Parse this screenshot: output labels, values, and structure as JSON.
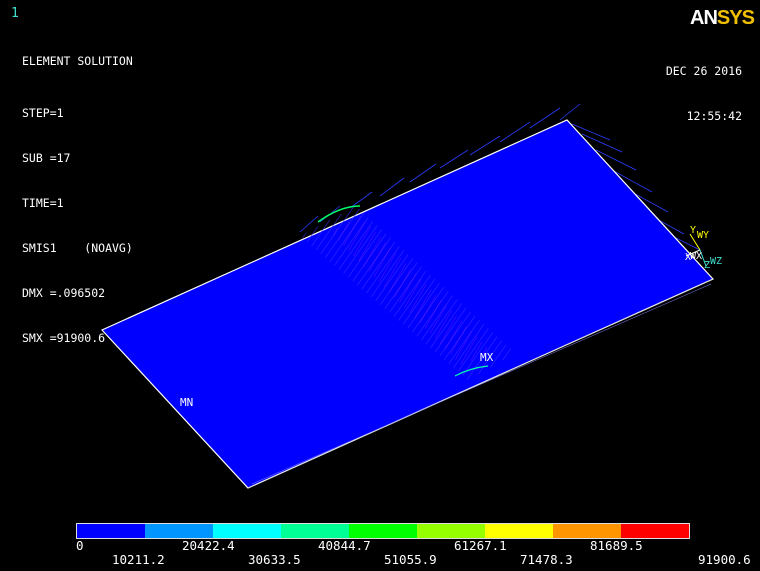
{
  "window": {
    "number": "1"
  },
  "logo": {
    "an": "AN",
    "sys": "SYS"
  },
  "info": {
    "title": "ELEMENT SOLUTION",
    "step": "STEP=1",
    "sub": "SUB =17",
    "time": "TIME=1",
    "item": "SMIS1    (NOAVG)",
    "dmx": "DMX =.096502",
    "smx": "SMX =91900.6"
  },
  "datetime": {
    "date": "DEC 26 2016",
    "time": "12:55:42"
  },
  "plot": {
    "mn_label": "MN",
    "mx_label": "MX",
    "triad": {
      "y": "Y",
      "wy": "WY",
      "x": "X",
      "wx": "WX",
      "z": "Z",
      "wz": "WZ"
    },
    "plate_color": "#0000ff",
    "edge_color": "#ffffff"
  },
  "legend": {
    "colors": [
      "#0000ff",
      "#0095ff",
      "#00ffff",
      "#00ff95",
      "#00ff00",
      "#95ff00",
      "#ffff00",
      "#ff9500",
      "#ff0000"
    ],
    "top_labels": [
      "0",
      "20422.4",
      "40844.7",
      "61267.1",
      "81689.5"
    ],
    "bottom_labels": [
      "10211.2",
      "30633.5",
      "51055.9",
      "71478.3",
      "91900.6"
    ]
  }
}
